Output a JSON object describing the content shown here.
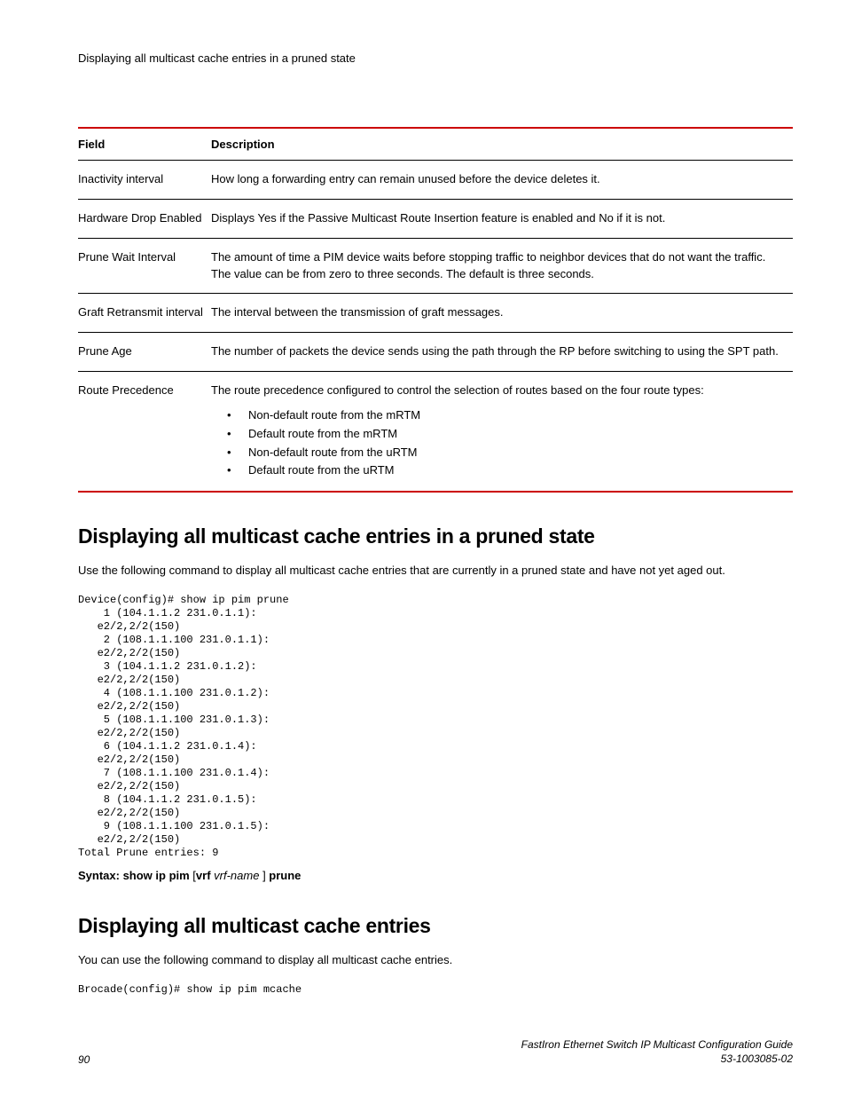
{
  "header": "Displaying all multicast cache entries in a pruned state",
  "table": {
    "headers": {
      "field": "Field",
      "description": "Description"
    },
    "rows": [
      {
        "field": "Inactivity interval",
        "description": "How long a forwarding entry can remain unused before the device deletes it."
      },
      {
        "field": "Hardware Drop Enabled",
        "description": "Displays Yes if the Passive Multicast Route Insertion feature is enabled and No if it is not."
      },
      {
        "field": "Prune Wait Interval",
        "description": "The amount of time a PIM device waits before stopping traffic to neighbor devices that do not want the traffic. The value can be from zero to three seconds. The default is three seconds."
      },
      {
        "field": "Graft Retransmit interval",
        "description": "The interval between the transmission of graft messages."
      },
      {
        "field": "Prune Age",
        "description": "The number of packets the device sends using the path through the RP before switching to using the SPT path."
      },
      {
        "field": "Route Precedence",
        "description": "The route precedence configured to control the selection of routes based on the four route types:",
        "list": [
          "Non-default route from the mRTM",
          "Default route from the mRTM",
          "Non-default route from the uRTM",
          "Default route from the uRTM"
        ]
      }
    ]
  },
  "section1": {
    "title": "Displaying all multicast cache entries in a pruned state",
    "intro": "Use the following command to display all multicast cache entries that are currently in a pruned state and have not yet aged out.",
    "code": "Device(config)# show ip pim prune\n    1 (104.1.1.2 231.0.1.1):\n   e2/2,2/2(150)\n    2 (108.1.1.100 231.0.1.1):\n   e2/2,2/2(150)\n    3 (104.1.1.2 231.0.1.2):\n   e2/2,2/2(150)\n    4 (108.1.1.100 231.0.1.2):\n   e2/2,2/2(150)\n    5 (108.1.1.100 231.0.1.3):\n   e2/2,2/2(150)\n    6 (104.1.1.2 231.0.1.4):\n   e2/2,2/2(150)\n    7 (108.1.1.100 231.0.1.4):\n   e2/2,2/2(150)\n    8 (104.1.1.2 231.0.1.5):\n   e2/2,2/2(150)\n    9 (108.1.1.100 231.0.1.5):\n   e2/2,2/2(150)\nTotal Prune entries: 9",
    "syntax": {
      "prefix": "Syntax: show ip pim",
      "opt_open": " [",
      "opt_kw": "vrf",
      "opt_var": " vrf-name ",
      "opt_close": "] ",
      "suffix": "prune"
    }
  },
  "section2": {
    "title": "Displaying all multicast cache entries",
    "intro": "You can use the following command to display all multicast cache entries.",
    "code": "Brocade(config)# show ip pim mcache"
  },
  "footer": {
    "page_number": "90",
    "doc_title": "FastIron Ethernet Switch IP Multicast Configuration Guide",
    "doc_rev": "53-1003085-02"
  }
}
